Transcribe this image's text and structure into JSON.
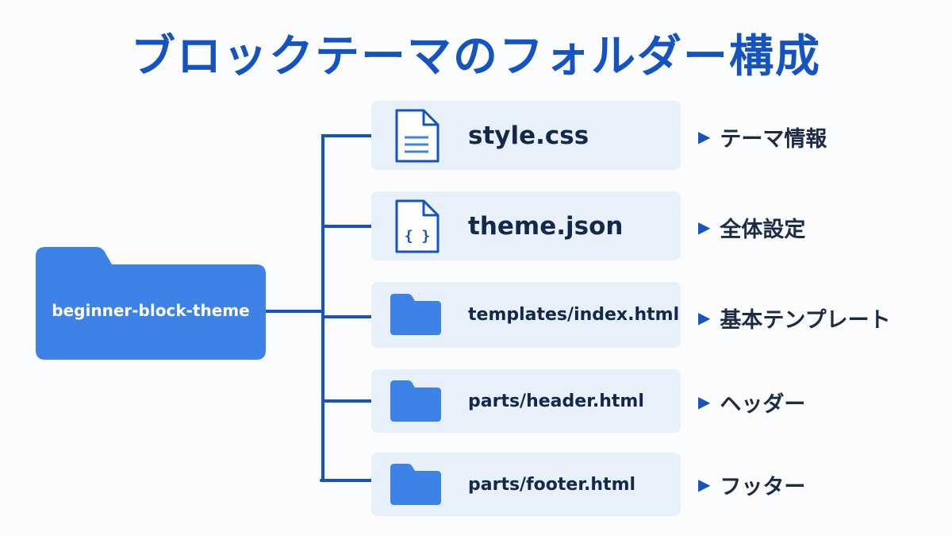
{
  "title": "ブロックテーマのフォルダー構成",
  "root": {
    "label": "beginner-block-theme",
    "icon": "folder-icon"
  },
  "files": [
    {
      "name": "style.css",
      "icon": "document-icon",
      "description": "テーマ情報"
    },
    {
      "name": "theme.json",
      "icon": "json-file-icon",
      "json_glyph": "{ }",
      "description": "全体設定"
    },
    {
      "name": "templates/index.html",
      "icon": "folder-icon",
      "description": "基本テンプレート"
    },
    {
      "name": "parts/header.html",
      "icon": "folder-icon",
      "description": "ヘッダー"
    },
    {
      "name": "parts/footer.html",
      "icon": "folder-icon",
      "description": "フッター"
    }
  ],
  "arrow_glyph": "▶",
  "colors": {
    "title": "#1553c0",
    "folder": "#3d82e6",
    "line": "#1553c0",
    "box": "#e8f0fa"
  }
}
